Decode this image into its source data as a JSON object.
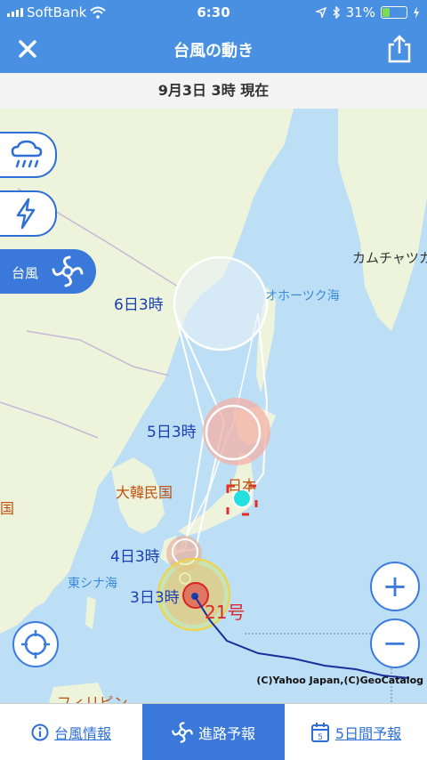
{
  "status": {
    "carrier": "SoftBank",
    "time": "6:30",
    "battery": "31%",
    "battery_level": 0.31
  },
  "header": {
    "title": "台風の動き"
  },
  "date_bar": {
    "text": "9月3日 3時 現在"
  },
  "sidebar": {
    "rain_icon": "rain-cloud-icon",
    "lightning_icon": "lightning-icon",
    "typhoon_label": "台風"
  },
  "map": {
    "labels": {
      "kamchatka": "カムチャツカ",
      "okhotsk": "オホーツク海",
      "japan": "日本",
      "korea": "大韓民国",
      "china_fragment": "国",
      "east_china_sea": "東シナ海",
      "philippines_fragment": "フィリピン"
    },
    "forecast_labels": [
      "6日3時",
      "5日3時",
      "4日3時",
      "3日3時"
    ],
    "typhoon_name": "21号",
    "copyright": "(C)Yahoo Japan,(C)GeoCatalog"
  },
  "controls": {
    "zoom_in": "+",
    "zoom_out": "−"
  },
  "tabs": [
    {
      "label": "台風情報",
      "icon": "info-icon",
      "active": false
    },
    {
      "label": "進路予報",
      "icon": "typhoon-icon",
      "active": true
    },
    {
      "label": "5日間予報",
      "icon": "calendar-icon",
      "calendar_day": "5",
      "active": false
    }
  ]
}
